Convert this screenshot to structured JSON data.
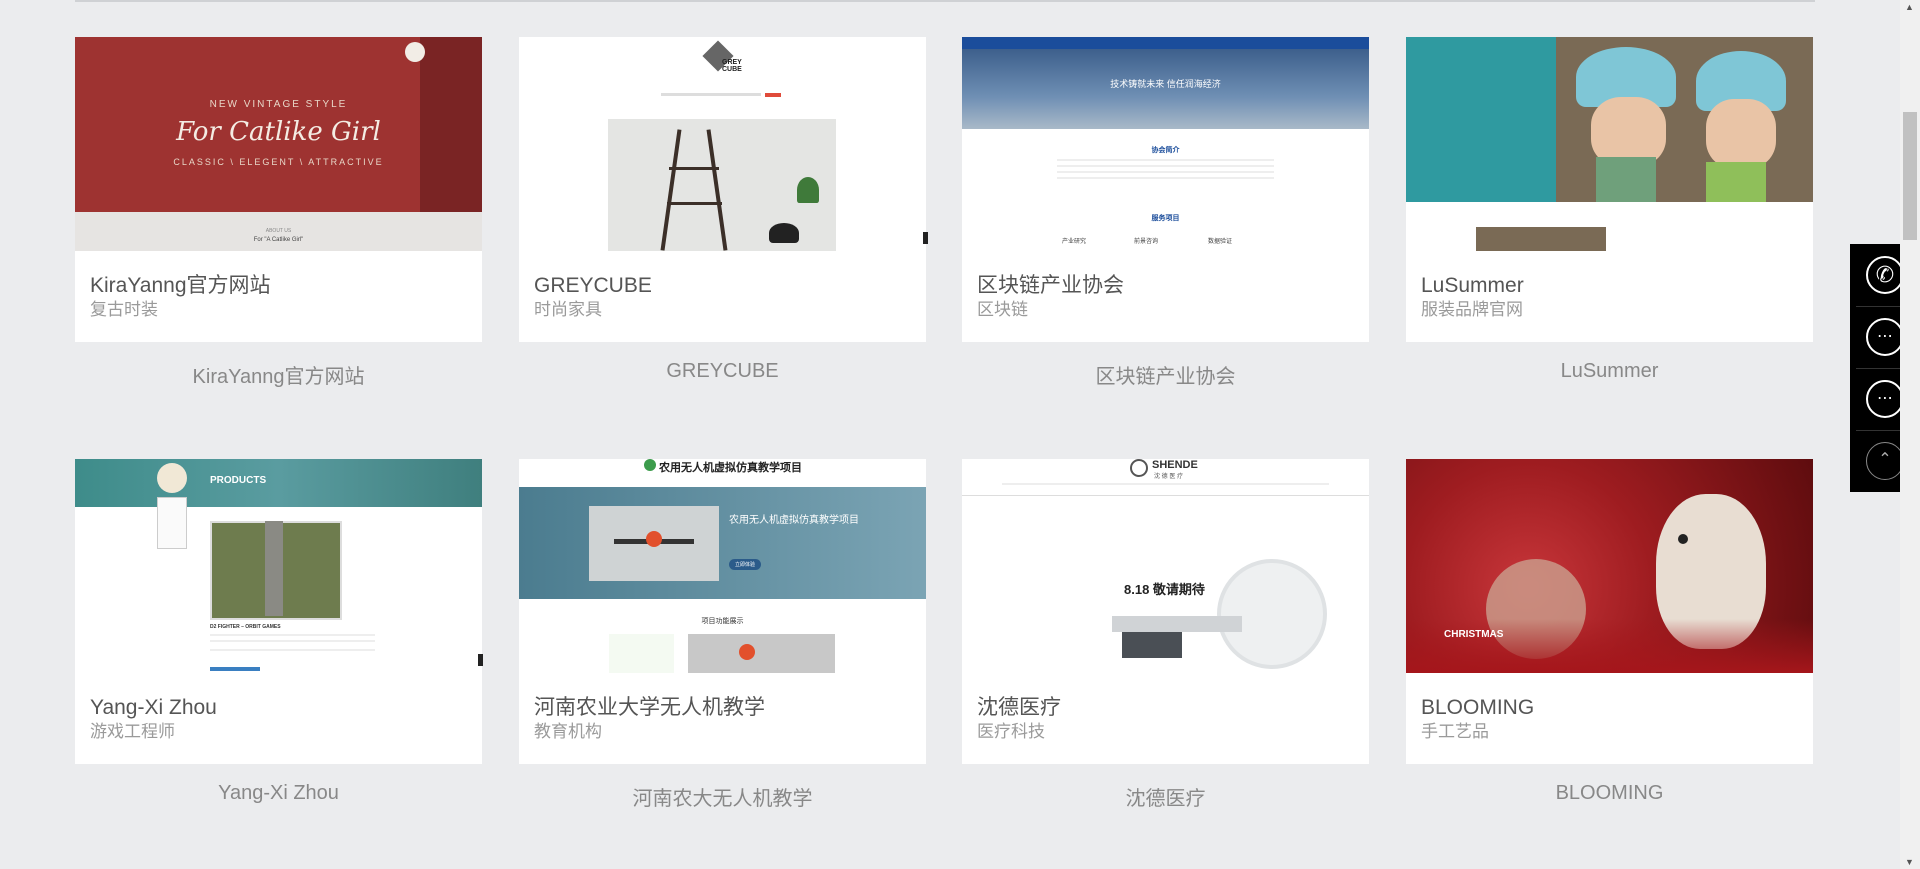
{
  "cards": [
    {
      "title": "KiraYanng官方网站",
      "subtitle": "复古时装",
      "caption": "KiraYanng官方网站",
      "thumb": {
        "line1": "NEW VINTAGE STYLE",
        "line2": "For Catlike Girl",
        "line3": "CLASSIC \\ ELEGENT \\ ATTRACTIVE",
        "about": "ABOUT US",
        "about2": "For \"A Catlike Girl\""
      }
    },
    {
      "title": "GREYCUBE",
      "subtitle": "时尚家具",
      "caption": "GREYCUBE",
      "thumb": {
        "logo1": "GREY",
        "logo2": "CUBE"
      }
    },
    {
      "title": "区块链产业协会",
      "subtitle": "区块链",
      "caption": "区块链产业协会",
      "thumb": {
        "banner": "技术铸就未来 信任润海经济",
        "intro": "协会简介",
        "services": "服务项目",
        "items": [
          "产业研究",
          "前景咨询",
          "数据验证"
        ]
      }
    },
    {
      "title": "LuSummer",
      "subtitle": "服装品牌官网",
      "caption": "LuSummer",
      "thumb": {}
    },
    {
      "title": "Yang-Xi Zhou",
      "subtitle": "游戏工程师",
      "caption": "Yang-Xi Zhou",
      "thumb": {
        "heading": "PRODUCTS",
        "game": "D2 FIGHTER – ORBIT GAMES"
      }
    },
    {
      "title": "河南农业大学无人机教学",
      "subtitle": "教育机构",
      "caption": "河南农大无人机教学",
      "thumb": {
        "header": "农用无人机虚拟仿真教学项目",
        "headline": "农用无人机虚拟仿真教学项目",
        "btn": "立即体验",
        "section": "项目功能展示"
      }
    },
    {
      "title": "沈德医疗",
      "subtitle": "医疗科技",
      "caption": "沈德医疗",
      "thumb": {
        "logo": "SHENDE",
        "logo_cn": "沈 德 医 疗",
        "promo": "8.18 敬请期待"
      }
    },
    {
      "title": "BLOOMING",
      "subtitle": "手工艺品",
      "caption": "BLOOMING",
      "thumb": {
        "word": "CHRISTMAS"
      }
    }
  ],
  "sidebar": {
    "phone": "phone-icon",
    "chat1": "chat-icon",
    "chat2": "wechat-icon",
    "top": "back-to-top-icon"
  },
  "colors": {
    "background": "#ebecee",
    "card": "#ffffff",
    "sidebar": "#000000",
    "title": "#555555",
    "subtitle": "#9a9a9a"
  }
}
